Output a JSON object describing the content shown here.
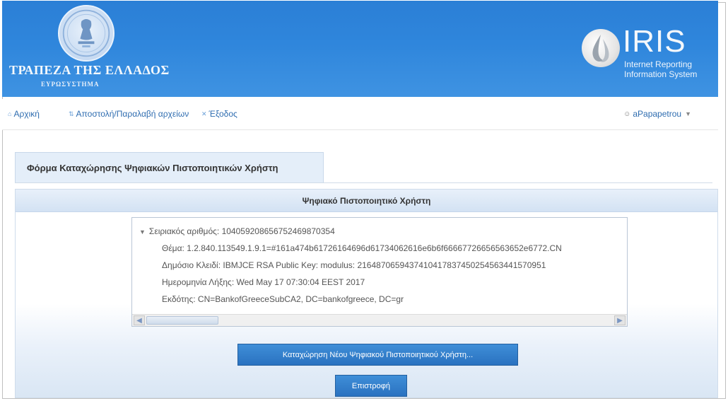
{
  "header": {
    "bank_name": "ΤΡΑΠΕΖΑ ΤΗΣ ΕΛΛΑΔΟΣ",
    "bank_sub": "ΕΥΡΩΣΥΣΤΗΜΑ",
    "iris_title": "IRIS",
    "iris_sub_line1": "Internet Reporting",
    "iris_sub_line2": "Information System",
    "colors": {
      "banner": "#2f86dc"
    }
  },
  "nav": {
    "home": "Αρχική",
    "transfer": "Αποστολή/Παραλαβή αρχείων",
    "logout": "Έξοδος",
    "user": "aPapapetrou",
    "icons": {
      "home": "home-icon",
      "transfer": "transfer-icon",
      "logout": "close-icon",
      "user": "user-icon",
      "caret": "caret-down-icon"
    }
  },
  "form": {
    "tab_title": "Φόρμα Καταχώρησης Ψηφιακών Πιστοποιητικών Χρήστη",
    "panel_title": "Ψηφιακό Πιστοποιητικό Χρήστη",
    "tree": {
      "root": "Σειριακός αριθμός: 104059208656752469870354",
      "children": [
        "Θέμα: 1.2.840.113549.1.9.1=#161a474b61726164696d61734062616e6b6f66667726656563652e6772.CN",
        "Δημόσιο Κλειδί: IBMJCE RSA Public Key: modulus: 2164870659437410417837450254563441570951",
        "Ημερομηνία Λήξης: Wed May 17 07:30:04 EEST 2017",
        "Εκδότης: CN=BankofGreeceSubCA2, DC=bankofgreece, DC=gr"
      ]
    },
    "buttons": {
      "new_cert": "Καταχώρηση Νέου Ψηφιακού Πιστοποιητικού Χρήστη...",
      "back": "Επιστροφή"
    }
  }
}
